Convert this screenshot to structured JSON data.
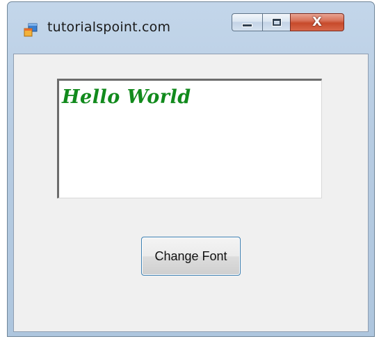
{
  "window": {
    "title": "tutorialspoint.com",
    "icon": "windows-form-icon"
  },
  "caption_buttons": {
    "minimize": "minimize-icon",
    "maximize": "maximize-icon",
    "close_label": "X"
  },
  "textbox": {
    "text": "Hello World",
    "text_color": "#118a1c"
  },
  "button": {
    "label": "Change Font"
  },
  "colors": {
    "title_bar": "#b7cce2",
    "close_button": "#c74a2b",
    "client_bg": "#f0f0f0",
    "button_border": "#3c7fb1"
  }
}
